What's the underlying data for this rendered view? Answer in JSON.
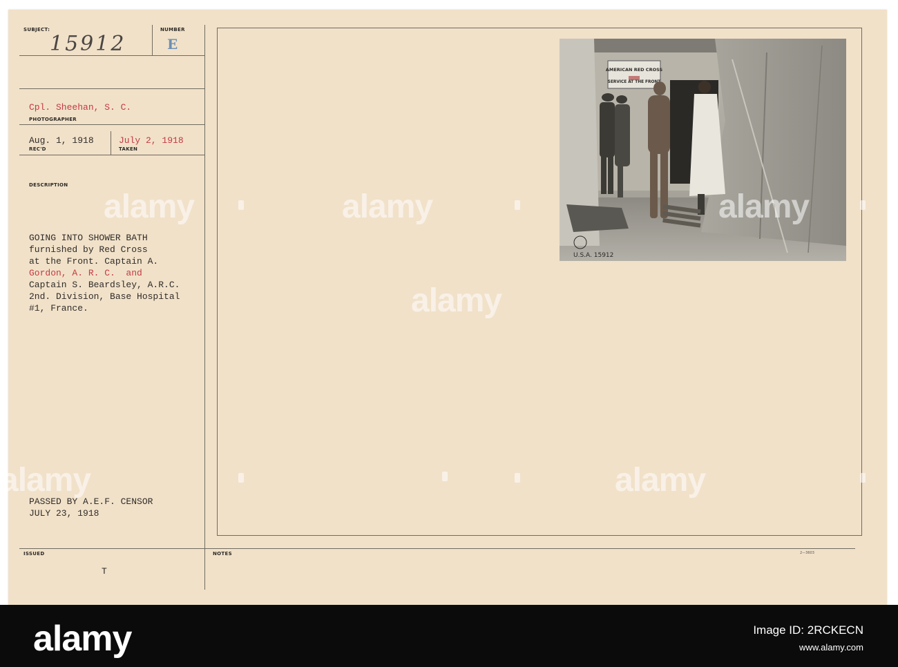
{
  "card": {
    "labels": {
      "subject": "SUBJECT:",
      "number": "NUMBER",
      "photographer": "PHOTOGRAPHER",
      "recd": "REC'D",
      "taken": "TAKEN",
      "description": "DESCRIPTION",
      "issued": "ISSUED",
      "notes": "NOTES"
    },
    "subject_number": "15912",
    "number_stamp": "E",
    "photographer_line": "Cpl. Sheehan, S. C.",
    "recd_date": "Aug. 1, 1918",
    "taken_date": "July 2, 1918",
    "description_lines": [
      "GOING INTO SHOWER BATH",
      "furnished by Red Cross",
      "at the Front. Captain A.",
      "Gordon, A. R. C.  and",
      "Captain S. Beardsley, A.R.C.",
      "2nd. Division, Base Hospital",
      "#1, France."
    ],
    "censor_lines": [
      "PASSED BY A.E.F. CENSOR",
      "JULY 23, 1918"
    ],
    "issued_mark": "T",
    "form_number": "2—3603"
  },
  "photo": {
    "sign_line1": "AMERICAN RED CROSS",
    "sign_line2": "SERVICE AT THE FRONT",
    "stamp_text": "U.S.A. 15912"
  },
  "watermarks": [
    "alamy",
    "alamy",
    "alamy",
    "alamy",
    "alamy",
    "alamy",
    "alamy",
    "alamy",
    "alamy",
    "alamy",
    "alamy",
    "alamy"
  ],
  "footer": {
    "logo": "alamy",
    "image_id_label": "Image ID: 2RCKECN",
    "site": "www.alamy.com"
  }
}
